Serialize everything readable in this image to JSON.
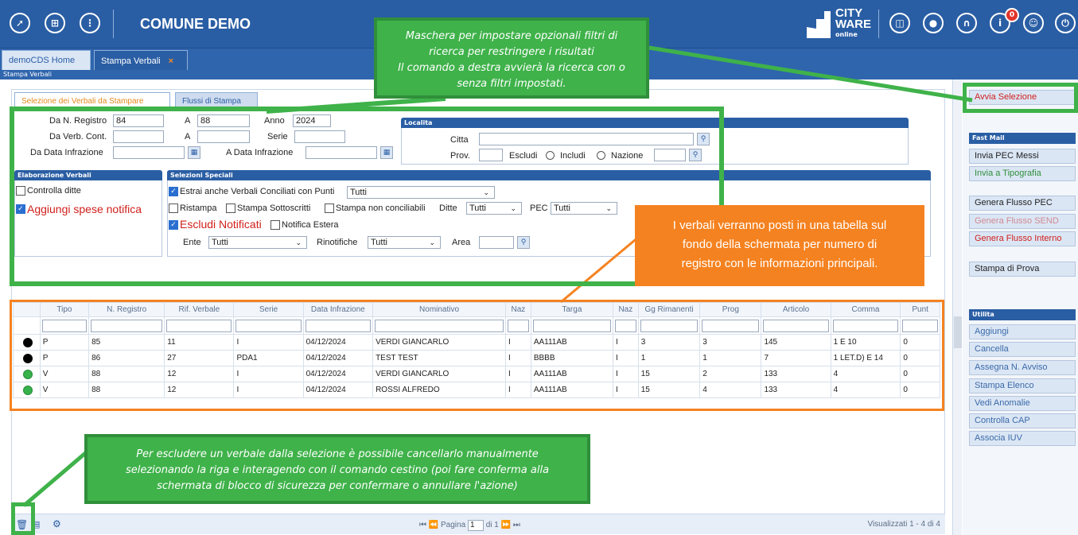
{
  "header": {
    "app_title": "COMUNE DEMO",
    "logo_line1": "CITY",
    "logo_line2": "WARE",
    "logo_sub": "online",
    "notification_count": "0"
  },
  "tabs": [
    {
      "label": "demoCDS Home"
    },
    {
      "label": "Stampa Verbali",
      "close": "×"
    }
  ],
  "breadcrumb": "Stampa Verbali",
  "subtabs": [
    "Selezione dei Verbali da Stampare",
    "Flussi di Stampa"
  ],
  "form": {
    "da_n_registro_label": "Da N. Registro",
    "da_n_registro_value": "84",
    "a_label": "A",
    "a_value": "88",
    "anno_label": "Anno",
    "anno_value": "2024",
    "da_verb_cont_label": "Da Verb. Cont.",
    "a2_label": "A",
    "serie_label": "Serie",
    "da_data_infrazione_label": "Da Data Infrazione",
    "a_data_infrazione_label": "A Data Infrazione",
    "localita_title": "Localita",
    "citta_label": "Citta",
    "prov_label": "Prov.",
    "escludi_label": "Escludi",
    "includi_label": "Includi",
    "nazione_label": "Nazione"
  },
  "elaborazione": {
    "title": "Elaborazione Verbali",
    "controlla_ditte": "Controlla ditte",
    "aggiungi_spese": "Aggiungi spese notifica"
  },
  "selezioni": {
    "title": "Selezioni Speciali",
    "estrai_label": "Estrai anche Verbali Conciliati con Punti",
    "estrai_value": "Tutti",
    "ristampa": "Ristampa",
    "stampa_sottoscritti": "Stampa Sottoscritti",
    "stampa_non_conciliabili": "Stampa non conciliabili",
    "ditte_label": "Ditte",
    "ditte_value": "Tutti",
    "pec_label": "PEC",
    "pec_value": "Tutti",
    "escludi_notificati": "Escludi Notificati",
    "notifica_estera": "Notifica Estera",
    "ente_label": "Ente",
    "ente_value": "Tutti",
    "rinotifiche_label": "Rinotifiche",
    "rinotifiche_value": "Tutti",
    "area_label": "Area"
  },
  "table": {
    "columns": [
      "",
      "Tipo",
      "N. Registro",
      "Rif. Verbale",
      "Serie",
      "Data Infrazione",
      "Nominativo",
      "Naz",
      "Targa",
      "Naz",
      "Gg Rimanenti",
      "Prog",
      "Articolo",
      "Comma",
      "Punt"
    ],
    "rows": [
      {
        "status": "black",
        "cells": [
          "P",
          "85",
          "11",
          "I",
          "04/12/2024",
          "VERDI GIANCARLO",
          "I",
          "AA111AB",
          "I",
          "3",
          "3",
          "145",
          "1 E 10",
          "0"
        ]
      },
      {
        "status": "black",
        "cells": [
          "P",
          "86",
          "27",
          "PDA1",
          "04/12/2024",
          "TEST TEST",
          "I",
          "BBBB",
          "I",
          "1",
          "1",
          "7",
          "1 LET.D) E 14",
          "0"
        ]
      },
      {
        "status": "green",
        "cells": [
          "V",
          "88",
          "12",
          "I",
          "04/12/2024",
          "VERDI GIANCARLO",
          "I",
          "AA111AB",
          "I",
          "15",
          "2",
          "133",
          "4",
          "0"
        ]
      },
      {
        "status": "green",
        "cells": [
          "V",
          "88",
          "12",
          "I",
          "04/12/2024",
          "ROSSI ALFREDO",
          "I",
          "AA111AB",
          "I",
          "15",
          "4",
          "133",
          "4",
          "0"
        ]
      }
    ]
  },
  "pager": {
    "pagina_label": "Pagina",
    "page_value": "1",
    "di_label": "di 1",
    "visualizzati": "Visualizzati 1 - 4 di 4"
  },
  "right_panel": {
    "avvia": "Avvia Selezione",
    "fast_mail_title": "Fast Mail",
    "invia_pec": "Invia PEC Messi",
    "invia_tipografia": "Invia a Tipografia",
    "genera_pec": "Genera Flusso PEC",
    "genera_send": "Genera Flusso SEND",
    "genera_interno": "Genera Flusso Interno",
    "stampa_prova": "Stampa di Prova",
    "utilita_title": "Utilita",
    "aggiungi": "Aggiungi",
    "cancella": "Cancella",
    "assegna": "Assegna N. Avviso",
    "stampa_elenco": "Stampa Elenco",
    "vedi_anomalie": "Vedi Anomalie",
    "controlla_cap": "Controlla CAP",
    "associa_iuv": "Associa IUV"
  },
  "callouts": {
    "top": [
      "Maschera per impostare opzionali filtri di",
      "ricerca per restringere i risultati",
      "Il comando a destra avvierà la ricerca con o",
      "senza filtri impostati."
    ],
    "orange": [
      "I verbali verranno posti in una tabella sul",
      "fondo della schermata per numero di",
      "registro con le informazioni principali."
    ],
    "bottom": [
      "Per escludere un verbale dalla selezione è possibile cancellarlo manualmente",
      "selezionando la riga e interagendo con il comando cestino (poi fare conferma alla",
      "schermata di blocco di sicurezza per confermare o annullare l'azione)"
    ]
  },
  "colors": {
    "header_blue": "#2a5ea4",
    "callout_green": "#3fb24a",
    "callout_orange": "#f58220",
    "accent_red": "#d0201c",
    "accent_green": "#2f8f3a"
  }
}
